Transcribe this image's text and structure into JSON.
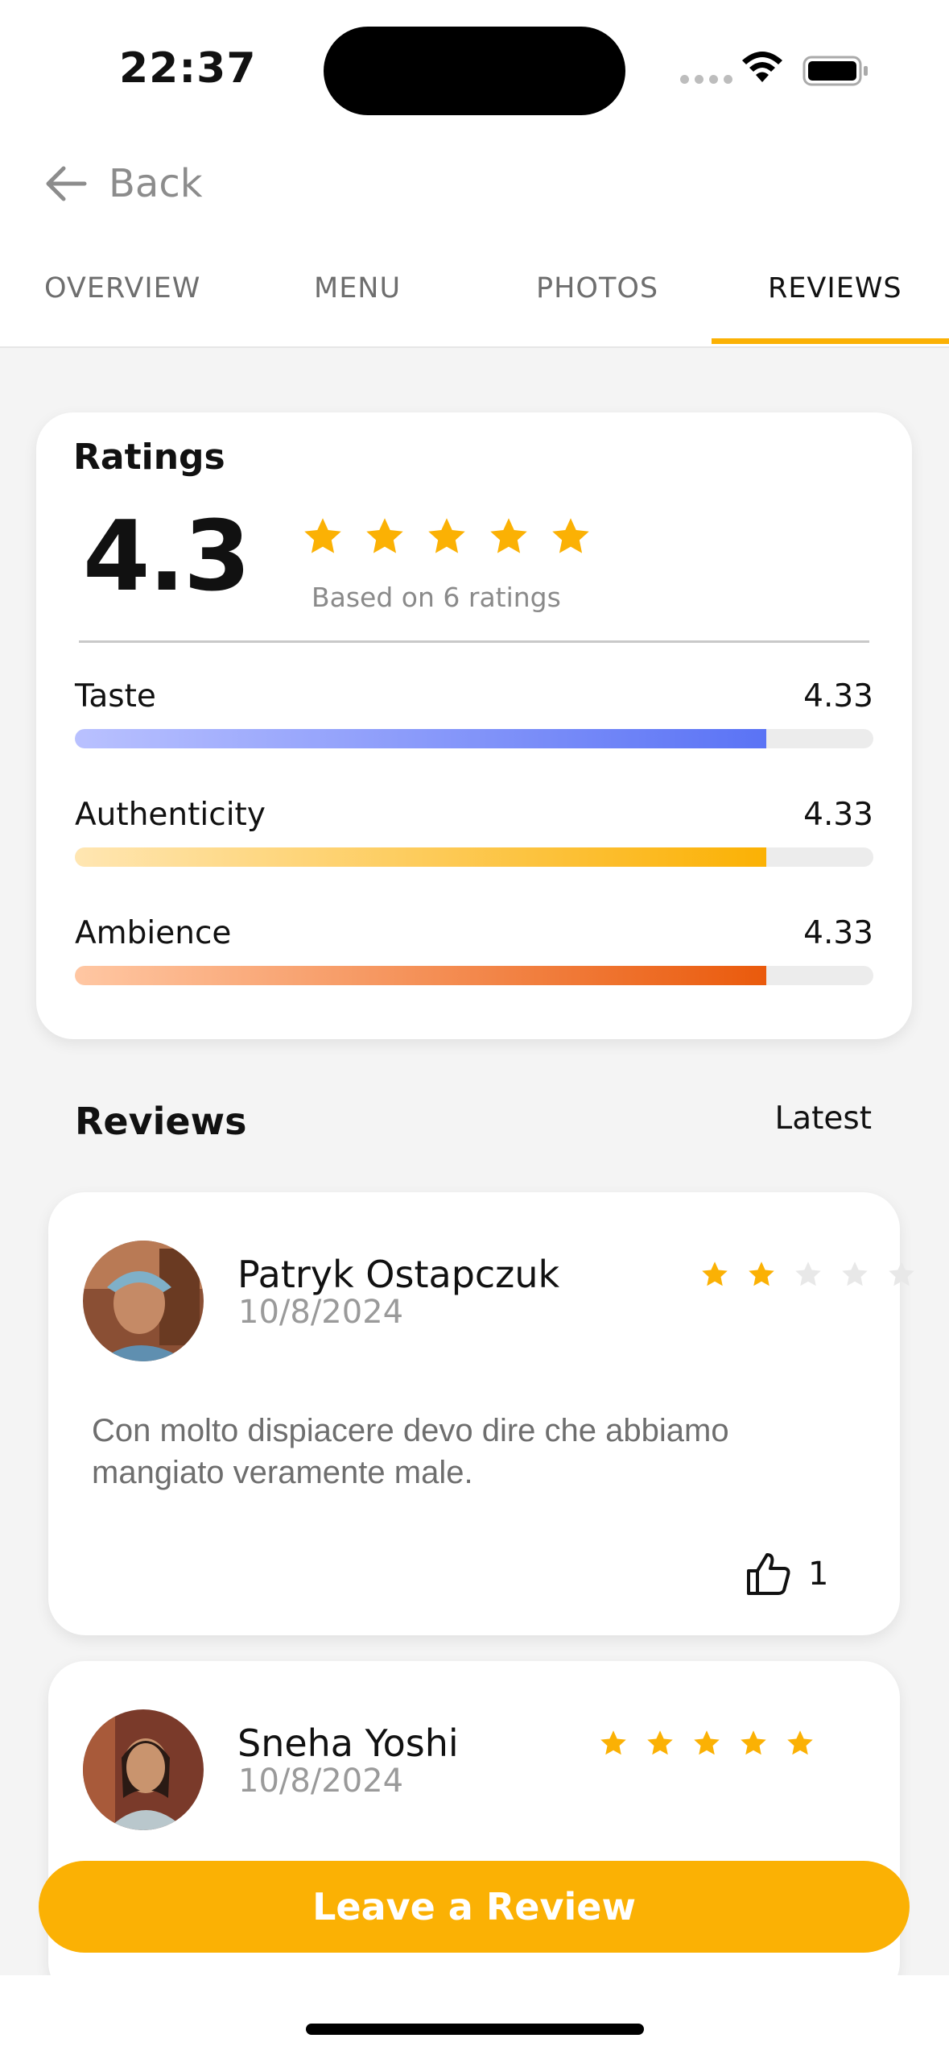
{
  "status_bar": {
    "time": "22:37"
  },
  "nav": {
    "back_label": "Back"
  },
  "tabs": [
    {
      "label": "OVERVIEW",
      "active": false
    },
    {
      "label": "MENU",
      "active": false
    },
    {
      "label": "PHOTOS",
      "active": false
    },
    {
      "label": "REVIEWS",
      "active": true
    }
  ],
  "ratings": {
    "title": "Ratings",
    "overall": "4.3",
    "star_count": 5,
    "based_on": "Based on 6 ratings",
    "categories": [
      {
        "name": "Taste",
        "value": "4.33",
        "fraction": 0.866,
        "gradient_start": "#b9c1ff",
        "gradient_end": "#5a73f5"
      },
      {
        "name": "Authenticity",
        "value": "4.33",
        "fraction": 0.866,
        "gradient_start": "#ffe6b2",
        "gradient_end": "#fbb104"
      },
      {
        "name": "Ambience",
        "value": "4.33",
        "fraction": 0.866,
        "gradient_start": "#ffc7a3",
        "gradient_end": "#ea5a0c"
      }
    ]
  },
  "reviews_section": {
    "title": "Reviews",
    "sort": "Latest",
    "items": [
      {
        "name": "Patryk Ostapczuk",
        "date": "10/8/2024",
        "stars_filled": 2,
        "stars_total": 5,
        "text": "Con molto dispiacere devo dire che abbiamo mangiato veramente male.",
        "likes": "1"
      },
      {
        "name": "Sneha Yoshi",
        "date": "10/8/2024",
        "stars_filled": 5,
        "stars_total": 5,
        "text": "",
        "likes": ""
      }
    ]
  },
  "cta": {
    "label": "Leave a Review"
  },
  "colors": {
    "accent": "#fbb104",
    "star_empty": "#e8e8e8"
  }
}
